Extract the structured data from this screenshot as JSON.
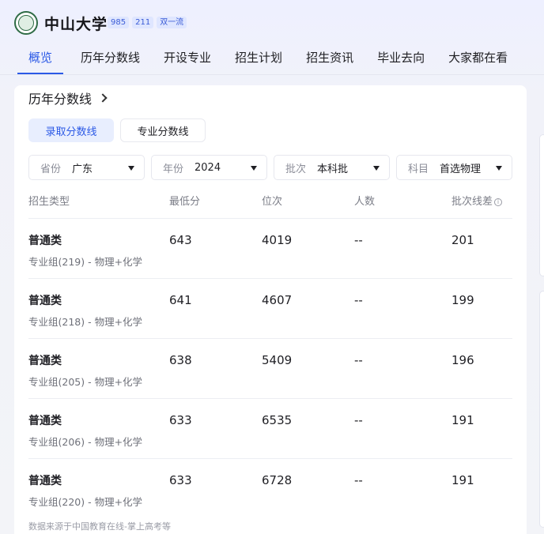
{
  "header": {
    "university": "中山大学",
    "badges": [
      "985",
      "211",
      "双一流"
    ]
  },
  "tabs": [
    {
      "label": "概览",
      "active": true
    },
    {
      "label": "历年分数线",
      "active": false
    },
    {
      "label": "开设专业",
      "active": false
    },
    {
      "label": "招生计划",
      "active": false
    },
    {
      "label": "招生资讯",
      "active": false
    },
    {
      "label": "毕业去向",
      "active": false
    },
    {
      "label": "大家都在看",
      "active": false
    }
  ],
  "section": {
    "title": "历年分数线",
    "segments": [
      "录取分数线",
      "专业分数线"
    ]
  },
  "filters": {
    "province": {
      "label": "省份",
      "value": "广东"
    },
    "year": {
      "label": "年份",
      "value": "2024"
    },
    "batch": {
      "label": "批次",
      "value": "本科批"
    },
    "subject": {
      "label": "科目",
      "value": "首选物理"
    }
  },
  "table": {
    "headers": [
      "招生类型",
      "最低分",
      "位次",
      "人数",
      "批次线差"
    ],
    "rows": [
      {
        "type": "普通类",
        "group": "专业组(219) - 物理+化学",
        "min": "643",
        "rank": "4019",
        "count": "--",
        "diff": "201"
      },
      {
        "type": "普通类",
        "group": "专业组(218) - 物理+化学",
        "min": "641",
        "rank": "4607",
        "count": "--",
        "diff": "199"
      },
      {
        "type": "普通类",
        "group": "专业组(205) - 物理+化学",
        "min": "638",
        "rank": "5409",
        "count": "--",
        "diff": "196"
      },
      {
        "type": "普通类",
        "group": "专业组(206) - 物理+化学",
        "min": "633",
        "rank": "6535",
        "count": "--",
        "diff": "191"
      },
      {
        "type": "普通类",
        "group": "专业组(220) - 物理+化学",
        "min": "633",
        "rank": "6728",
        "count": "--",
        "diff": "191"
      }
    ]
  },
  "footer": "数据来源于中国教育在线-掌上高考等",
  "colors": {
    "accent": "#2b59e6",
    "segment_bg": "#e8eefe",
    "badge_bg": "#dfe6ff"
  }
}
